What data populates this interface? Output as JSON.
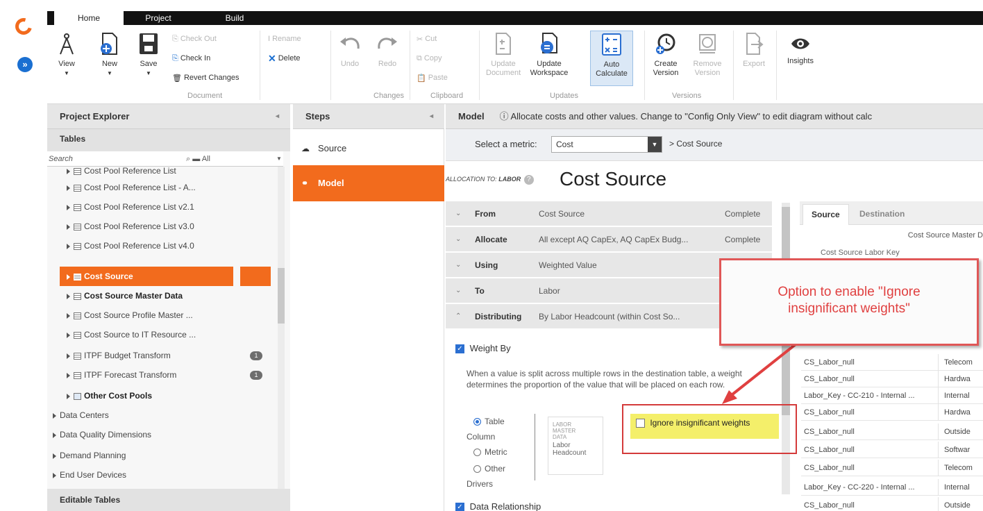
{
  "ribbon": {
    "tabs": [
      "Home",
      "Project",
      "Build"
    ],
    "buttons": {
      "view": "View",
      "new": "New",
      "save": "Save",
      "check_out": "Check Out",
      "check_in": "Check In",
      "revert": "Revert Changes",
      "rename": "Rename",
      "delete": "Delete",
      "undo": "Undo",
      "redo": "Redo",
      "cut": "Cut",
      "copy": "Copy",
      "paste": "Paste",
      "update_document_1": "Update",
      "update_document_2": "Document",
      "update_workspace_1": "Update",
      "update_workspace_2": "Workspace",
      "auto_calc_1": "Auto",
      "auto_calc_2": "Calculate",
      "create_version_1": "Create",
      "create_version_2": "Version",
      "remove_version_1": "Remove",
      "remove_version_2": "Version",
      "export": "Export",
      "insights": "Insights"
    },
    "groups": {
      "document": "Document",
      "changes": "Changes",
      "clipboard": "Clipboard",
      "updates": "Updates",
      "versions": "Versions"
    }
  },
  "project_explorer": {
    "title": "Project Explorer",
    "tables_label": "Tables",
    "search_placeholder": "Search",
    "filter_all": "All",
    "items": [
      "Cost Pool Reference List",
      "Cost Pool Reference List - A...",
      "Cost Pool Reference List v2.1",
      "Cost Pool Reference List v3.0",
      "Cost Pool Reference List v4.0",
      "Cost Source",
      "Cost Source Master Data",
      "Cost Source Profile Master ...",
      "Cost Source to IT Resource ...",
      "ITPF Budget Transform",
      "ITPF Forecast Transform",
      "Other Cost Pools",
      "Data Centers",
      "Data Quality Dimensions",
      "Demand Planning",
      "End User Devices"
    ],
    "badge_1": "1",
    "badge_2": "1",
    "editable_tables": "Editable Tables"
  },
  "steps": {
    "title": "Steps",
    "items": [
      "Source",
      "Model"
    ]
  },
  "model": {
    "title": "Model",
    "info": "Allocate costs and other values. Change to \"Config Only View\" to edit diagram without calc",
    "metric_label": "Select a metric:",
    "metric_value": "Cost",
    "breadcrumb": "> Cost Source",
    "allocation_to": "ALLOCATION TO:",
    "allocation_target": "LABOR",
    "heading": "Cost Source",
    "rows": [
      {
        "key": "From",
        "value": "Cost Source",
        "status": "Complete"
      },
      {
        "key": "Allocate",
        "value": "All except AQ CapEx, AQ CapEx Budg...",
        "status": "Complete"
      },
      {
        "key": "Using",
        "value": "Weighted Value",
        "status": ""
      },
      {
        "key": "To",
        "value": "Labor",
        "status": ""
      },
      {
        "key": "Distributing",
        "value": "By Labor Headcount (within Cost So...",
        "status": ""
      }
    ],
    "weight_by": "Weight By",
    "weight_desc": "When a value is split across multiple rows in the destination table, a weight determines the proportion of the value that will be placed on each row.",
    "radio_table": "Table",
    "radio_column": "Column",
    "radio_metric": "Metric",
    "radio_other": "Other",
    "radio_drivers": "Drivers",
    "labor_master_1": "LABOR",
    "labor_master_2": "MASTER",
    "labor_master_3": "DATA",
    "labor_headcount_1": "Labor",
    "labor_headcount_2": "Headcount",
    "ignore_label": "Ignore insignificant weights",
    "data_relationship": "Data Relationship"
  },
  "right_panel": {
    "tabs": [
      "Source",
      "Destination"
    ],
    "subtitle": "Cost Source Master D",
    "col_header": "Cost Source Labor Key",
    "rows": [
      [
        "CS_Labor_null",
        "Telecom"
      ],
      [
        "CS_Labor_null",
        "Hardwa"
      ],
      [
        "Labor_Key - CC-210 - Internal ...",
        "Internal"
      ],
      [
        "CS_Labor_null",
        "Hardwa"
      ],
      [
        "CS_Labor_null",
        "Outside"
      ],
      [
        "CS_Labor_null",
        "Softwar"
      ],
      [
        "CS_Labor_null",
        "Telecom"
      ],
      [
        "Labor_Key - CC-220 - Internal ...",
        "Internal"
      ],
      [
        "CS_Labor_null",
        "Outside"
      ]
    ]
  },
  "callout": {
    "line1": "Option to enable \"Ignore",
    "line2": "insignificant weights\""
  },
  "colors": {
    "accent": "#f26b1d",
    "callout_red": "#e05757",
    "highlight": "#f4ef6a"
  }
}
